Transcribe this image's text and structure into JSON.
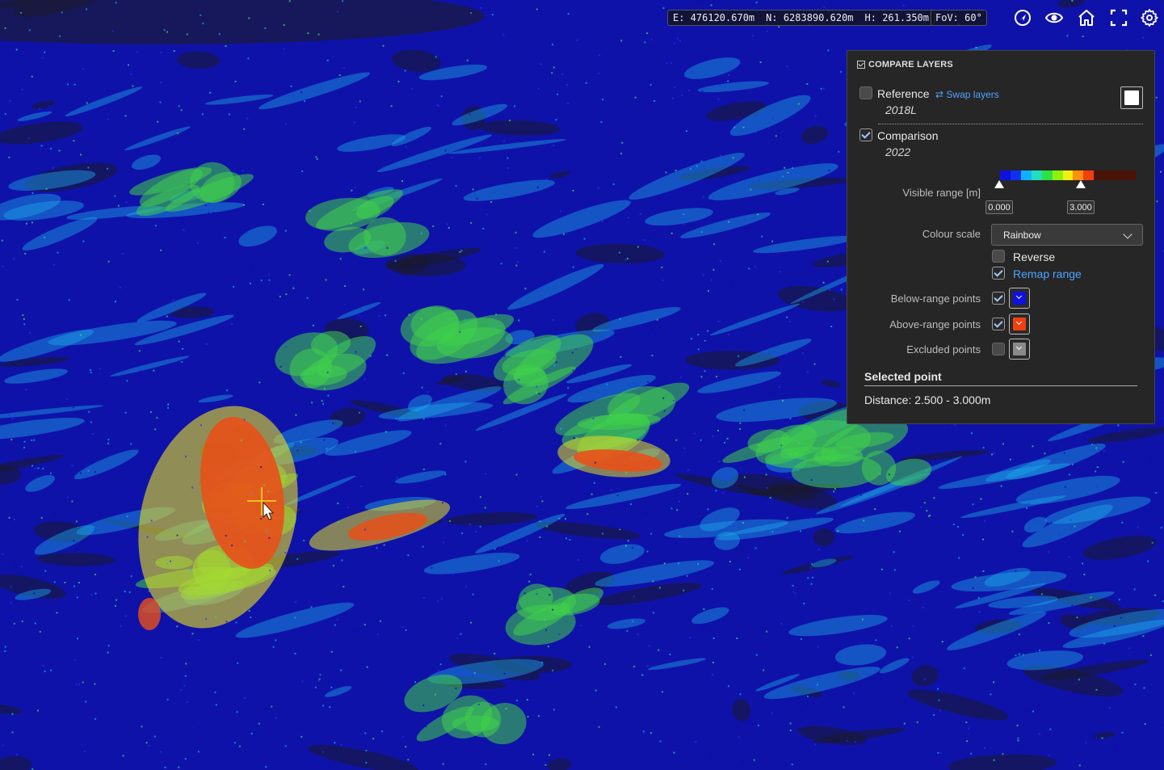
{
  "viewer": {
    "coord_e": "E: 476120.670m",
    "coord_n": "N: 6283890.620m",
    "coord_h": "H: 261.350m",
    "fov": "FoV: 60°",
    "tools": [
      "navigate-icon",
      "eye-icon",
      "home-icon",
      "fullscreen-icon",
      "gear-icon"
    ]
  },
  "panel": {
    "title": "COMPARE LAYERS",
    "reference_label": "Reference",
    "reference_value": "2018L",
    "swap_label": "Swap layers",
    "comparison_label": "Comparison",
    "comparison_value": "2022",
    "visible_range_label": "Visible range [m]",
    "range_min": "0.000",
    "range_max": "3.000",
    "colour_scale_label": "Colour scale",
    "colour_scale_value": "Rainbow",
    "reverse_label": "Reverse",
    "remap_label": "Remap range",
    "below_label": "Below-range points",
    "above_label": "Above-range points",
    "excluded_label": "Excluded points",
    "selected_title": "Selected point",
    "distance_text": "Distance: 2.500 - 3.000m",
    "reference_checked": false,
    "comparison_checked": true,
    "reverse_checked": false,
    "remap_checked": true,
    "below_checked": true,
    "above_checked": true,
    "excluded_checked": false
  },
  "colors": {
    "below_range": "#1010e0",
    "above_range": "#f04010",
    "excluded": "#8a8a8a",
    "rainbow": [
      "#1010e0",
      "#1030f0",
      "#10b0ff",
      "#20e0c0",
      "#30e040",
      "#90f010",
      "#f0f010",
      "#ff9010",
      "#f04010",
      "#4a1308",
      "#4a1308",
      "#4a1308",
      "#4a1308"
    ]
  }
}
